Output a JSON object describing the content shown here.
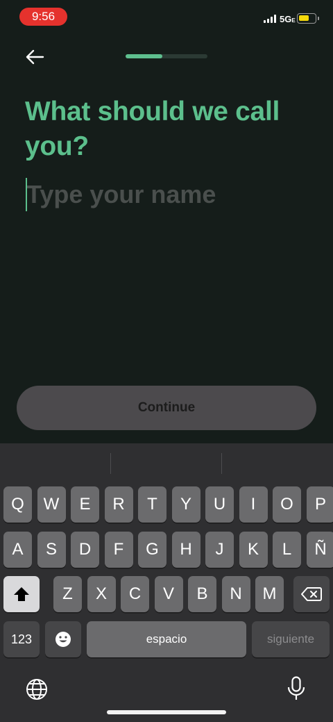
{
  "status_bar": {
    "time": "9:56",
    "network": "5G",
    "network_suffix": "E",
    "battery_color": "#f5d90a"
  },
  "header": {
    "back_icon": "arrow-left-icon",
    "progress_fraction": 0.45
  },
  "main": {
    "question": "What should we call you?",
    "name_input": {
      "value": "",
      "placeholder": "Type your name"
    },
    "continue_label": "Continue"
  },
  "keyboard": {
    "row1": [
      "Q",
      "W",
      "E",
      "R",
      "T",
      "Y",
      "U",
      "I",
      "O",
      "P"
    ],
    "row2": [
      "A",
      "S",
      "D",
      "F",
      "G",
      "H",
      "J",
      "K",
      "L",
      "Ñ"
    ],
    "row3": [
      "Z",
      "X",
      "C",
      "V",
      "B",
      "N",
      "M"
    ],
    "numbers_label": "123",
    "space_label": "espacio",
    "next_label": "siguiente"
  },
  "colors": {
    "accent": "#5cbf8c",
    "background": "#151d1a",
    "keyboard_bg": "#2f2f31"
  }
}
